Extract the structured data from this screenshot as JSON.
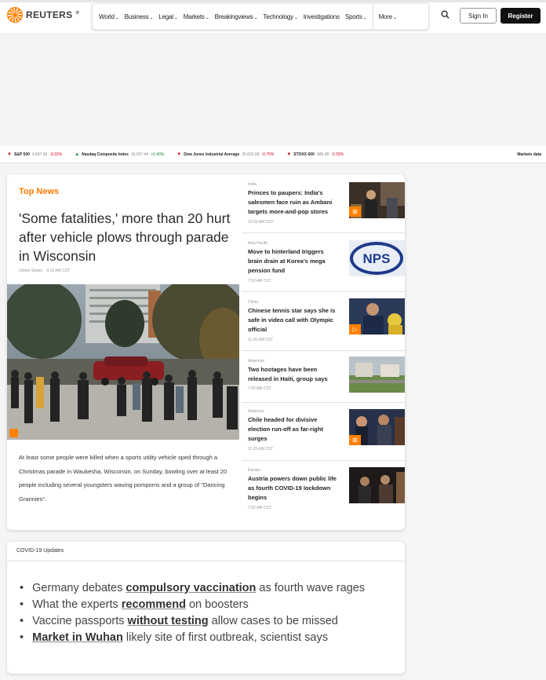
{
  "header": {
    "logo_text": "REUTERS",
    "nav": [
      {
        "label": "World",
        "dropdown": true
      },
      {
        "label": "Business",
        "dropdown": true
      },
      {
        "label": "Legal",
        "dropdown": true
      },
      {
        "label": "Markets",
        "dropdown": true
      },
      {
        "label": "Breakingviews",
        "dropdown": true
      },
      {
        "label": "Technology",
        "dropdown": true
      },
      {
        "label": "Investigations",
        "dropdown": false
      },
      {
        "label": "Sports",
        "dropdown": true
      },
      {
        "label": "More",
        "dropdown": true
      }
    ],
    "sign_in": "Sign In",
    "register": "Register"
  },
  "ticker": {
    "items": [
      {
        "name": "S&P 500",
        "value": "4,697.96",
        "change": "-0.32%",
        "direction": "down"
      },
      {
        "name": "Nasdaq Composite Index",
        "value": "16,057.44",
        "change": "+0.40%",
        "direction": "up"
      },
      {
        "name": "Dow Jones Industrial Average",
        "value": "35,602.98",
        "change": "-0.75%",
        "direction": "down"
      },
      {
        "name": "STOXX 600",
        "value": "486.08",
        "change": "-0.33%",
        "direction": "down"
      }
    ],
    "markets_data_link": "Markets data"
  },
  "top_news": {
    "section_title": "Top News",
    "lead": {
      "headline": "'Some fatalities,' more than 20 hurt after vehicle plows through parade in Wisconsin",
      "location": "United States",
      "time": "9:13 AM CST",
      "summary": "At least some people were killed when a sports utility vehicle sped through a Christmas parade in Waukesha, Wisconsin, on Sunday, bowling over at least 20 people including several youngsters waving pompoms and a group of \"Dancing Grannies\"."
    },
    "side_stories": [
      {
        "category": "India",
        "headline": "Princes to paupers: India's salesmen face ruin as Ambani targets more-and-pop stores",
        "time": "10:03 AM CST",
        "badge": "gallery"
      },
      {
        "category": "Asia Pacific",
        "headline": "Move to hinterland triggers brain drain at Korea's mega pension fund",
        "time": "7:52 AM CST",
        "badge": ""
      },
      {
        "category": "China",
        "headline": "Chinese tennis star says she is safe in video call with Olympic official",
        "time": "11:00 AM CST",
        "badge": "video"
      },
      {
        "category": "Americas",
        "headline": "Two hostages have been released in Haiti, group says",
        "time": "7:45 AM CST",
        "badge": ""
      },
      {
        "category": "Americas",
        "headline": "Chile headed for divisive election run-off as far-right surges",
        "time": "11:25 AM CST",
        "badge": "gallery"
      },
      {
        "category": "Europe",
        "headline": "Austria powers down public life as fourth COVID-19 lockdown begins",
        "time": "7:52 AM CST",
        "badge": ""
      }
    ]
  },
  "covid": {
    "title": "COVID-19 Updates",
    "items": [
      {
        "before": "Germany debates ",
        "link": "compulsory vaccination",
        "after": " as fourth wave rages"
      },
      {
        "before": "What the experts ",
        "link": "recommend",
        "after": " on boosters"
      },
      {
        "before": "Vaccine passports ",
        "link": "without testing",
        "after": " allow cases to be missed"
      },
      {
        "before": "",
        "link": "Market in Wuhan",
        "after": " likely site of first outbreak, scientist says"
      }
    ]
  },
  "colors": {
    "brand_orange": "#ff8000",
    "down": "#d0021b",
    "up": "#1a8a3a"
  }
}
